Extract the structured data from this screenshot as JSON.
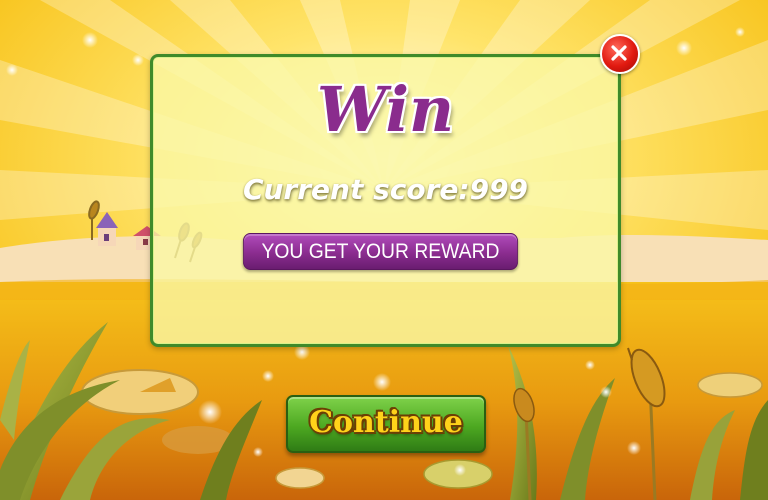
{
  "dialog": {
    "title": "Win",
    "score_label": "Current score:",
    "score_value": "999",
    "reward_text": "YOU GET YOUR REWARD"
  },
  "buttons": {
    "continue_label": "Continue",
    "close_icon": "close-icon"
  },
  "colors": {
    "title_purple": "#8a2c8d",
    "banner_purple": "#8a2c8f",
    "panel_border_green": "#3f8a2a",
    "continue_green": "#4da821",
    "continue_text_yellow": "#ffd21a",
    "close_red": "#e11a10",
    "sky_yellow": "#ffd23a"
  },
  "scene": {
    "icons": [
      "sun-rays",
      "houses",
      "cattail-plants",
      "lily-pads",
      "sparkles",
      "reeds"
    ]
  }
}
